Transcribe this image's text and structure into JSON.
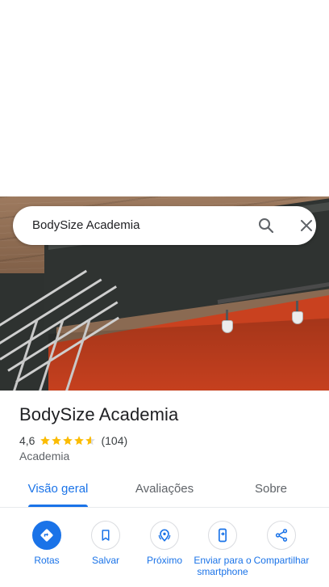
{
  "search": {
    "query": "BodySize Academia",
    "search_icon": "search-icon",
    "close_icon": "close-icon"
  },
  "place": {
    "name": "BodySize Academia",
    "rating": "4,6",
    "rating_stars": 4.6,
    "review_count": "(104)",
    "category": "Academia"
  },
  "tabs": [
    {
      "label": "Visão geral",
      "active": true
    },
    {
      "label": "Avaliações",
      "active": false
    },
    {
      "label": "Sobre",
      "active": false
    }
  ],
  "actions": [
    {
      "label": "Rotas",
      "icon": "directions-icon"
    },
    {
      "label": "Salvar",
      "icon": "bookmark-icon"
    },
    {
      "label": "Próximo",
      "icon": "nearby-icon"
    },
    {
      "label": "Enviar para o smartphone",
      "icon": "send-to-phone-icon"
    },
    {
      "label": "Compartilhar",
      "icon": "share-icon"
    }
  ],
  "colors": {
    "accent": "#1a73e8",
    "star": "#fbbc04",
    "text_primary": "#202124",
    "text_secondary": "#5f6368"
  }
}
